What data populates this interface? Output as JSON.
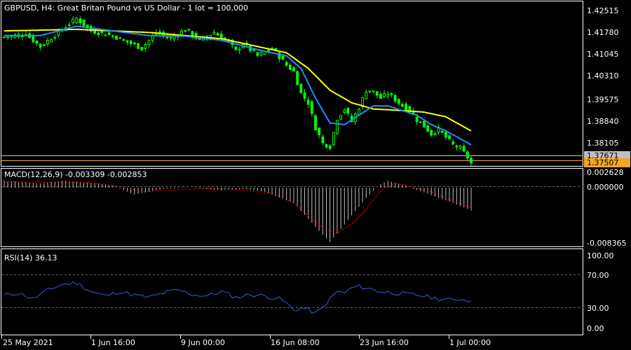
{
  "colors": {
    "background": "#000000",
    "frame": "#ffffff",
    "candles": "#00ff00",
    "ma_fast": "#1e90ff",
    "ma_slow": "#ffff00",
    "macd_histogram": "#c0c0c0",
    "macd_signal": "#ff0000",
    "rsi_line": "#3c5ad7",
    "ask_label_bg": "#c0c0c0",
    "bid_label_bg": "#f5a623"
  },
  "header": {
    "symbol_info": "GBPUSD, H4:  Great Britan Pound vs US Dollar - 1 lot = 100,000"
  },
  "price_panel": {
    "ask_label": "1.37671",
    "bid_label": "1.37507",
    "y_ticks": [
      "1.42515",
      "1.41780",
      "1.41045",
      "1.40310",
      "1.39575",
      "1.38840",
      "1.38105"
    ]
  },
  "macd_panel": {
    "title": "MACD(12,26,9) -0.003309 -0.002853",
    "y_ticks": [
      "0.002628",
      "0.000000",
      "-0.008365"
    ]
  },
  "rsi_panel": {
    "title": "RSI(14) 36.13",
    "y_ticks": [
      "100.00",
      "70.00",
      "30.00",
      "0.00"
    ]
  },
  "time_axis": {
    "labels": [
      "25 May 2021",
      "1 Jun 16:00",
      "9 Jun 00:00",
      "16 Jun 08:00",
      "23 Jun 16:00",
      "1 Jul 00:00"
    ]
  },
  "chart_data": [
    {
      "type": "line",
      "title": "GBPUSD, H4",
      "description_series": [
        {
          "name": "close",
          "color": "#00ff00"
        },
        {
          "name": "ma_fast",
          "color": "#1e90ff"
        },
        {
          "name": "ma_slow",
          "color": "#ffff00"
        }
      ],
      "ylim": [
        1.3745,
        1.4265
      ],
      "x_points": 130,
      "keypoints_close": [
        [
          0,
          1.4155
        ],
        [
          6,
          1.4165
        ],
        [
          10,
          1.4125
        ],
        [
          16,
          1.418
        ],
        [
          20,
          1.4215
        ],
        [
          24,
          1.4175
        ],
        [
          30,
          1.416
        ],
        [
          34,
          1.414
        ],
        [
          38,
          1.412
        ],
        [
          42,
          1.417
        ],
        [
          46,
          1.415
        ],
        [
          50,
          1.418
        ],
        [
          54,
          1.4145
        ],
        [
          58,
          1.417
        ],
        [
          62,
          1.414
        ],
        [
          64,
          1.411
        ],
        [
          66,
          1.4135
        ],
        [
          70,
          1.4095
        ],
        [
          74,
          1.412
        ],
        [
          78,
          1.4065
        ],
        [
          80,
          1.4045
        ],
        [
          82,
          1.3975
        ],
        [
          84,
          1.3945
        ],
        [
          86,
          1.3865
        ],
        [
          88,
          1.3815
        ],
        [
          90,
          1.3805
        ],
        [
          92,
          1.3895
        ],
        [
          94,
          1.3925
        ],
        [
          96,
          1.3885
        ],
        [
          98,
          1.393
        ],
        [
          100,
          1.3985
        ],
        [
          102,
          1.398
        ],
        [
          104,
          1.396
        ],
        [
          106,
          1.3975
        ],
        [
          108,
          1.3955
        ],
        [
          110,
          1.3935
        ],
        [
          112,
          1.392
        ],
        [
          114,
          1.389
        ],
        [
          116,
          1.387
        ],
        [
          118,
          1.3845
        ],
        [
          120,
          1.386
        ],
        [
          122,
          1.3835
        ],
        [
          124,
          1.381
        ],
        [
          126,
          1.38
        ],
        [
          128,
          1.377
        ],
        [
          129,
          1.3751
        ]
      ],
      "keypoints_ma_fast": [
        [
          0,
          1.416
        ],
        [
          10,
          1.416
        ],
        [
          20,
          1.419
        ],
        [
          30,
          1.4175
        ],
        [
          40,
          1.416
        ],
        [
          50,
          1.4158
        ],
        [
          60,
          1.4145
        ],
        [
          70,
          1.4115
        ],
        [
          78,
          1.4095
        ],
        [
          82,
          1.4055
        ],
        [
          86,
          1.396
        ],
        [
          90,
          1.388
        ],
        [
          94,
          1.3875
        ],
        [
          98,
          1.3905
        ],
        [
          102,
          1.3935
        ],
        [
          106,
          1.3935
        ],
        [
          110,
          1.392
        ],
        [
          114,
          1.3905
        ],
        [
          118,
          1.3875
        ],
        [
          122,
          1.3855
        ],
        [
          126,
          1.383
        ],
        [
          129,
          1.381
        ]
      ],
      "keypoints_ma_slow": [
        [
          0,
          1.4175
        ],
        [
          20,
          1.418
        ],
        [
          40,
          1.417
        ],
        [
          60,
          1.415
        ],
        [
          70,
          1.4125
        ],
        [
          78,
          1.4105
        ],
        [
          84,
          1.4055
        ],
        [
          90,
          1.3985
        ],
        [
          96,
          1.3945
        ],
        [
          102,
          1.3925
        ],
        [
          110,
          1.392
        ],
        [
          116,
          1.3915
        ],
        [
          122,
          1.39
        ],
        [
          129,
          1.3855
        ]
      ]
    },
    {
      "type": "bar",
      "title": "MACD(12,26,9)",
      "ylim": [
        -0.008365,
        0.002628
      ],
      "keypoints_histogram": [
        [
          0,
          0.001
        ],
        [
          10,
          0.0006
        ],
        [
          16,
          0.001
        ],
        [
          22,
          0.0008
        ],
        [
          30,
          0.0003
        ],
        [
          36,
          -0.001
        ],
        [
          44,
          -0.0002
        ],
        [
          52,
          0.0
        ],
        [
          60,
          -0.0004
        ],
        [
          66,
          -0.0002
        ],
        [
          72,
          -0.0006
        ],
        [
          80,
          -0.0022
        ],
        [
          84,
          -0.0045
        ],
        [
          88,
          -0.0068
        ],
        [
          90,
          -0.0078
        ],
        [
          92,
          -0.0066
        ],
        [
          96,
          -0.004
        ],
        [
          100,
          -0.0015
        ],
        [
          104,
          0.0005
        ],
        [
          106,
          0.001
        ],
        [
          110,
          0.0004
        ],
        [
          116,
          -0.0007
        ],
        [
          120,
          -0.0015
        ],
        [
          124,
          -0.0022
        ],
        [
          129,
          -0.0033
        ]
      ],
      "keypoints_signal": [
        [
          0,
          0.0008
        ],
        [
          14,
          0.0008
        ],
        [
          24,
          0.0007
        ],
        [
          32,
          0.0002
        ],
        [
          38,
          -0.0006
        ],
        [
          46,
          -0.0004
        ],
        [
          56,
          -0.0001
        ],
        [
          66,
          -0.0004
        ],
        [
          74,
          -0.0008
        ],
        [
          80,
          -0.0022
        ],
        [
          84,
          -0.004
        ],
        [
          88,
          -0.0058
        ],
        [
          92,
          -0.0066
        ],
        [
          96,
          -0.0052
        ],
        [
          100,
          -0.003
        ],
        [
          104,
          -0.0005
        ],
        [
          108,
          0.0007
        ],
        [
          112,
          0.0002
        ],
        [
          118,
          -0.0006
        ],
        [
          124,
          -0.0019
        ],
        [
          129,
          -0.0029
        ]
      ]
    },
    {
      "type": "line",
      "title": "RSI(14)",
      "ylim": [
        0,
        100
      ],
      "levels": [
        30,
        70
      ],
      "keypoints_rsi": [
        [
          0,
          45
        ],
        [
          4,
          48
        ],
        [
          8,
          40
        ],
        [
          12,
          52
        ],
        [
          16,
          60
        ],
        [
          20,
          62
        ],
        [
          24,
          50
        ],
        [
          28,
          44
        ],
        [
          32,
          50
        ],
        [
          36,
          45
        ],
        [
          40,
          42
        ],
        [
          44,
          48
        ],
        [
          48,
          52
        ],
        [
          52,
          46
        ],
        [
          56,
          44
        ],
        [
          60,
          50
        ],
        [
          64,
          42
        ],
        [
          68,
          46
        ],
        [
          72,
          44
        ],
        [
          76,
          40
        ],
        [
          78,
          34
        ],
        [
          80,
          24
        ],
        [
          82,
          28
        ],
        [
          84,
          25
        ],
        [
          86,
          20
        ],
        [
          88,
          28
        ],
        [
          90,
          40
        ],
        [
          92,
          50
        ],
        [
          94,
          48
        ],
        [
          96,
          55
        ],
        [
          98,
          57
        ],
        [
          100,
          55
        ],
        [
          104,
          50
        ],
        [
          108,
          48
        ],
        [
          112,
          46
        ],
        [
          116,
          44
        ],
        [
          120,
          40
        ],
        [
          124,
          38
        ],
        [
          126,
          40
        ],
        [
          129,
          36.13
        ]
      ]
    }
  ]
}
